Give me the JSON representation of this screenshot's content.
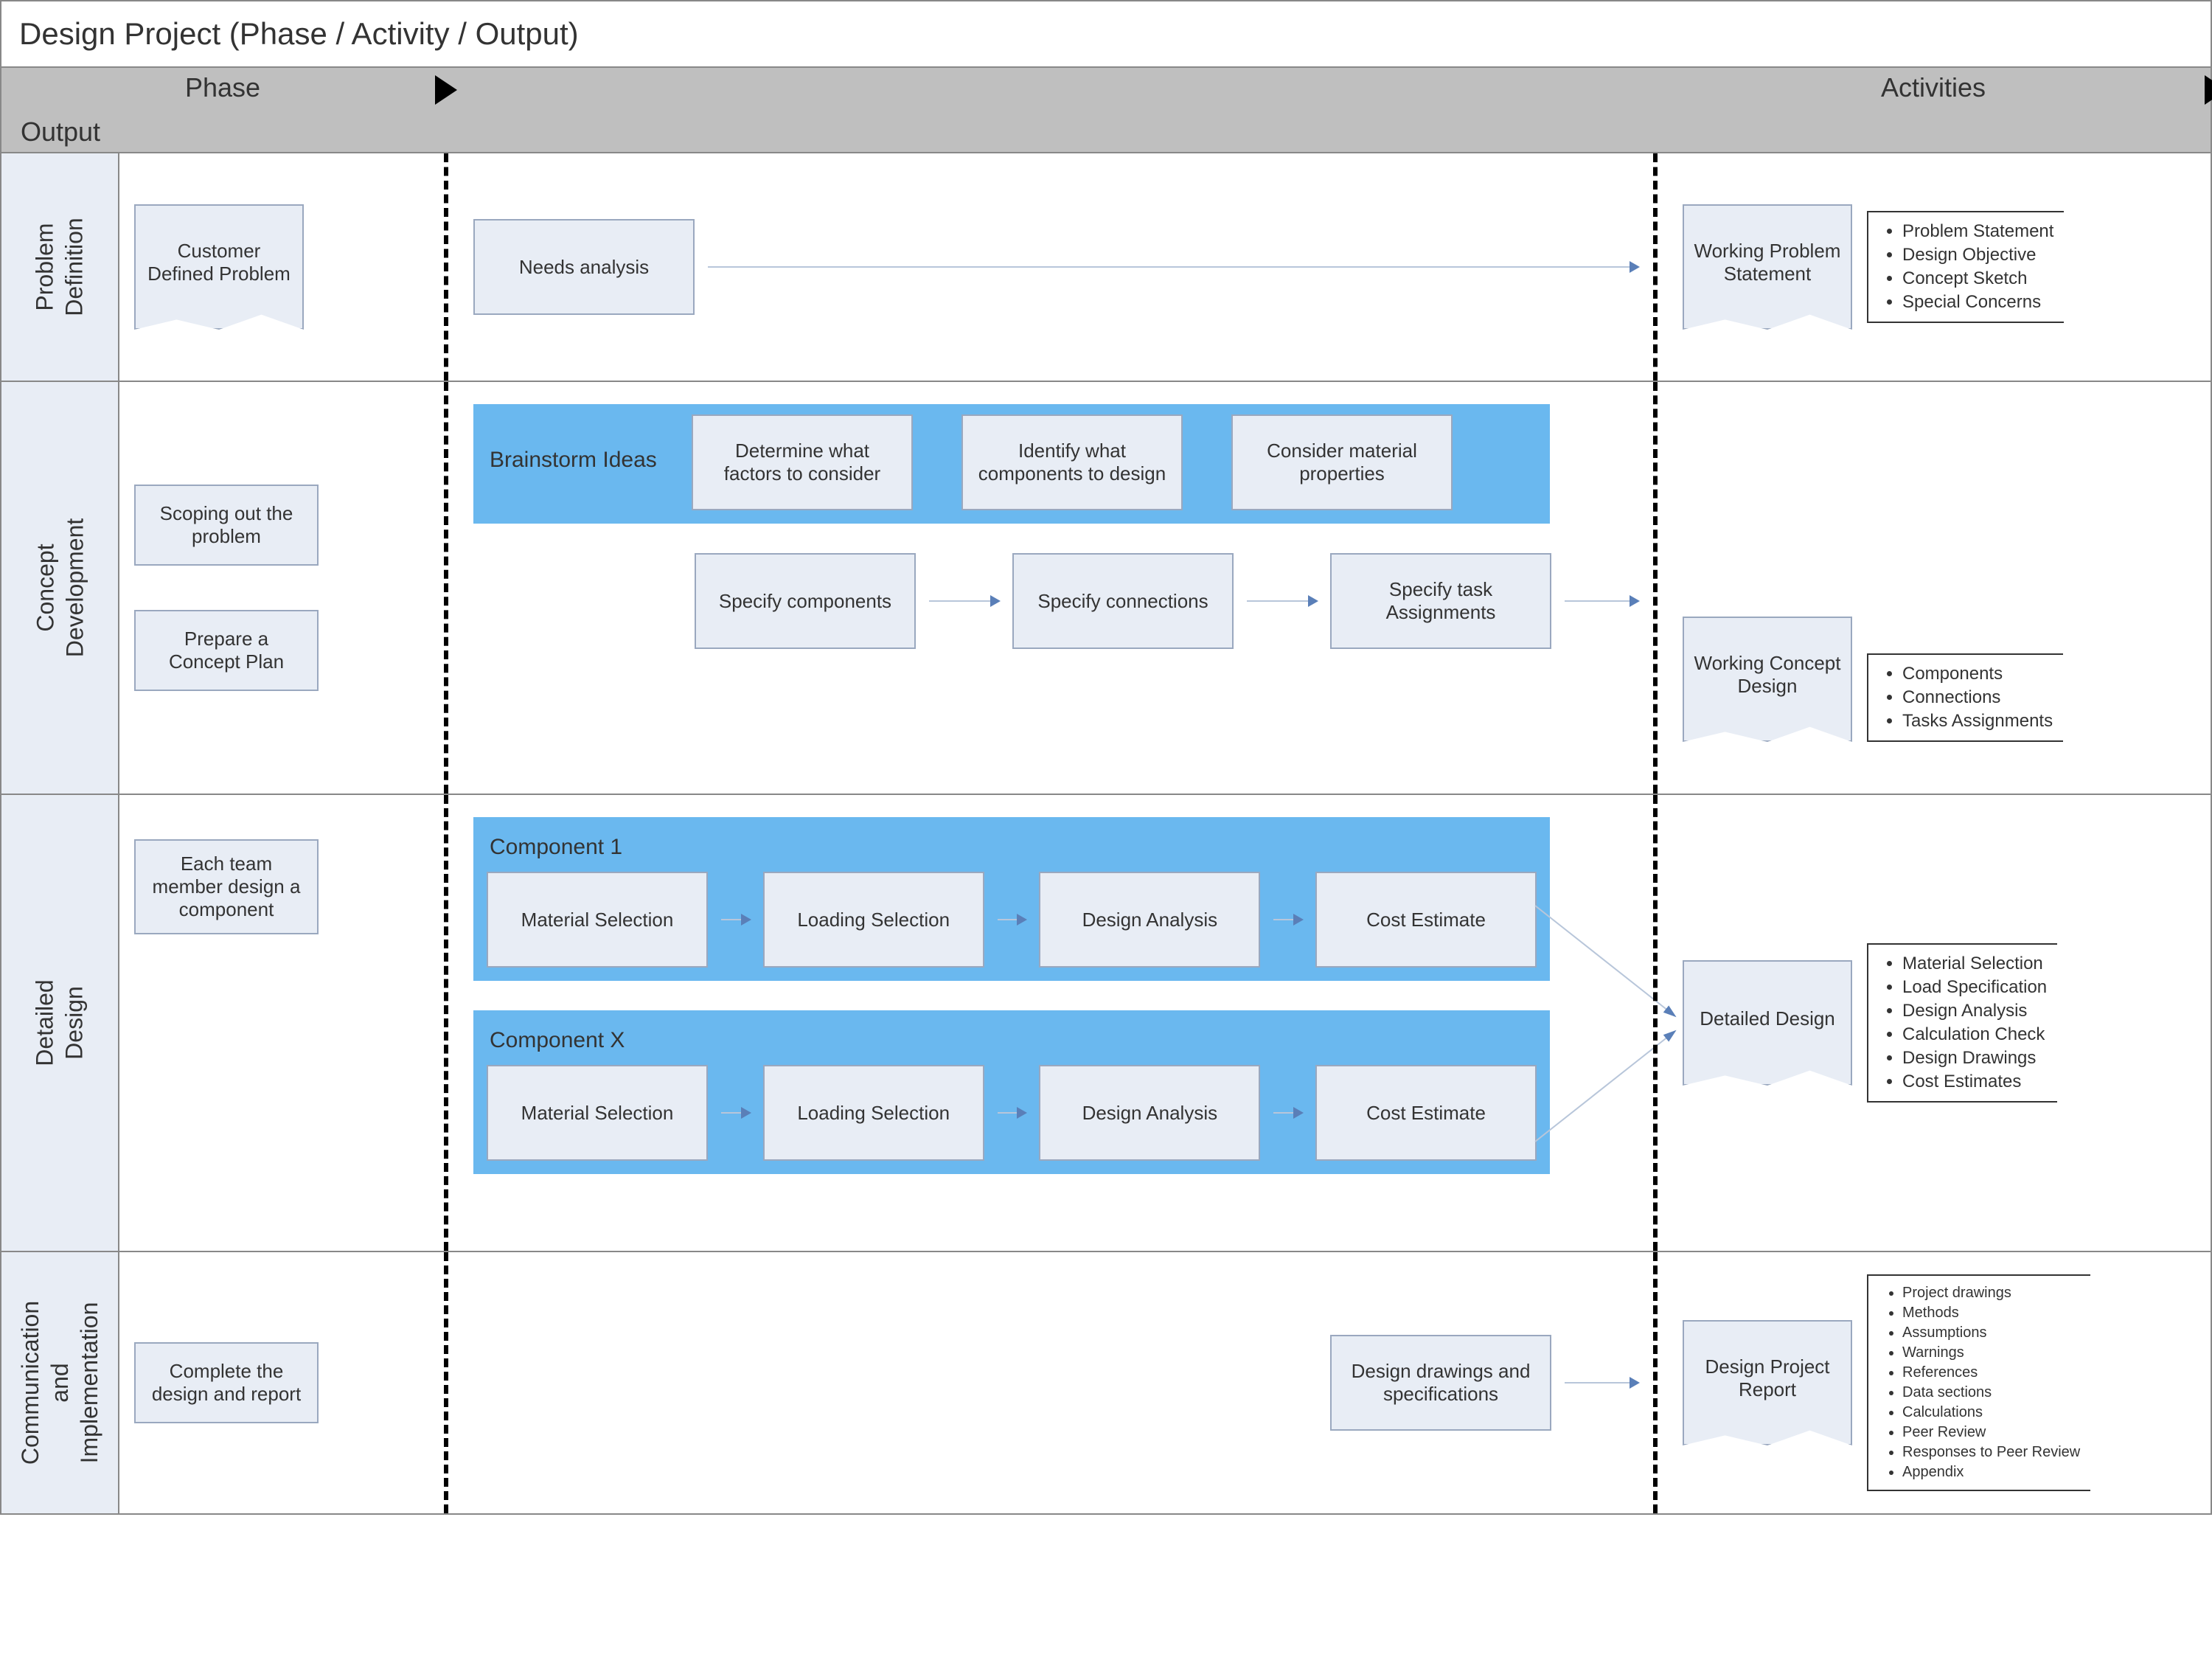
{
  "title": "Design Project (Phase / Activity / Output)",
  "header": {
    "phase": "Phase",
    "activities": "Activities",
    "output": "Output"
  },
  "phases": {
    "problem_definition": {
      "label": "Problem\nDefinition",
      "phase_boxes": [
        "Customer Defined Problem"
      ],
      "activity_flow": [
        "Needs analysis"
      ],
      "output_doc": "Working Problem Statement",
      "output_bullets": [
        "Problem Statement",
        "Design Objective",
        "Concept Sketch",
        "Special Concerns"
      ]
    },
    "concept_development": {
      "label": "Concept\nDevelopment",
      "phase_boxes": [
        "Scoping out the problem",
        "Prepare a Concept Plan"
      ],
      "brainstorm": {
        "label": "Brainstorm Ideas",
        "items": [
          "Determine what factors to consider",
          "Identify what components to design",
          "Consider material properties"
        ]
      },
      "flow": [
        "Specify components",
        "Specify connections",
        "Specify task Assignments"
      ],
      "output_doc": "Working Concept Design",
      "output_bullets": [
        "Components",
        "Connections",
        "Tasks Assignments"
      ]
    },
    "detailed_design": {
      "label": "Detailed\nDesign",
      "phase_boxes": [
        "Each team member design a component"
      ],
      "components": [
        {
          "label": "Component 1",
          "steps": [
            "Material Selection",
            "Loading Selection",
            "Design Analysis",
            "Cost Estimate"
          ]
        },
        {
          "label": "Component X",
          "steps": [
            "Material Selection",
            "Loading Selection",
            "Design Analysis",
            "Cost Estimate"
          ]
        }
      ],
      "output_doc": "Detailed Design",
      "output_bullets": [
        "Material Selection",
        "Load Specification",
        "Design Analysis",
        "Calculation Check",
        "Design Drawings",
        "Cost Estimates"
      ]
    },
    "communication_implementation": {
      "label": "Communication\nand\nImplementation",
      "phase_boxes": [
        "Complete the design and report"
      ],
      "activity_flow": [
        "Design drawings and specifications"
      ],
      "output_doc": "Design Project Report",
      "output_bullets": [
        "Project drawings",
        "Methods",
        "Assumptions",
        "Warnings",
        "References",
        "Data sections",
        "Calculations",
        "Peer Review",
        "Responses to Peer Review",
        "Appendix"
      ]
    }
  }
}
